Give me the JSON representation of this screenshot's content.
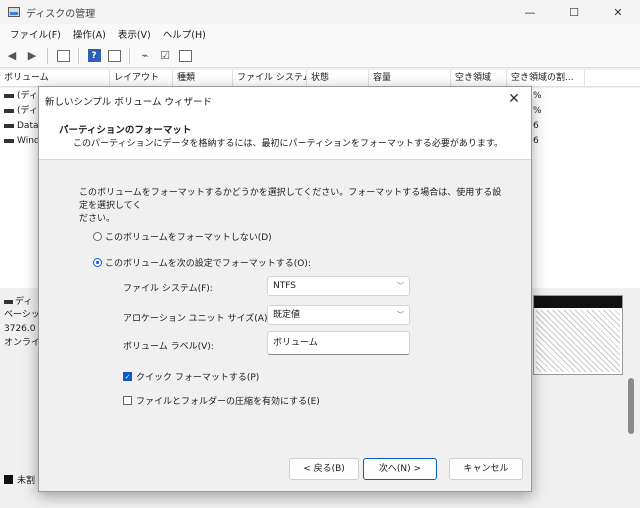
{
  "window": {
    "title": "ディスクの管理",
    "minimize": "—",
    "maximize": "☐",
    "close": "✕"
  },
  "menu": [
    "ファイル(F)",
    "操作(A)",
    "表示(V)",
    "ヘルプ(H)"
  ],
  "columns": [
    "ボリューム",
    "レイアウト",
    "種類",
    "ファイル システム",
    "状態",
    "容量",
    "空き領域",
    "空き領域の割..."
  ],
  "volumes": [
    {
      "name": "(ディス",
      "pct": "%"
    },
    {
      "name": "(ディス",
      "pct": "%"
    },
    {
      "name": "Data",
      "pct": "6"
    },
    {
      "name": "Wind",
      "pct": "6"
    }
  ],
  "disk_panel": {
    "name": "ディ",
    "type": "ベーシッ",
    "size": "3726.0",
    "status": "オンライ",
    "legend_unallocated": "未割"
  },
  "dialog": {
    "title": "新しいシンプル ボリューム ウィザード",
    "close": "✕",
    "header_title": "パーティションのフォーマット",
    "header_subtitle": "このパーティションにデータを格納するには、最初にパーティションをフォーマットする必要があります。",
    "intro_line1": "このボリュームをフォーマットするかどうかを選択してください。フォーマットする場合は、使用する設定を選択してく",
    "intro_line2": "ださい。",
    "radio_no_format": "このボリュームをフォーマットしない(D)",
    "radio_format": "このボリュームを次の設定でフォーマットする(O):",
    "fs_label": "ファイル システム(F):",
    "fs_value": "NTFS",
    "alloc_label": "アロケーション ユニット サイズ(A):",
    "alloc_value": "既定値",
    "vol_label_label": "ボリューム ラベル(V):",
    "vol_label_value": "ボリューム",
    "quick_format": "クイック フォーマットする(P)",
    "compress": "ファイルとフォルダーの圧縮を有効にする(E)",
    "back": "< 戻る(B)",
    "next": "次へ(N) >",
    "cancel": "キャンセル"
  },
  "state": {
    "format_selected": true,
    "quick_format_checked": true,
    "compress_checked": false
  },
  "colors": {
    "accent": "#0a5bc4",
    "window_bg": "#f0f0f0"
  }
}
